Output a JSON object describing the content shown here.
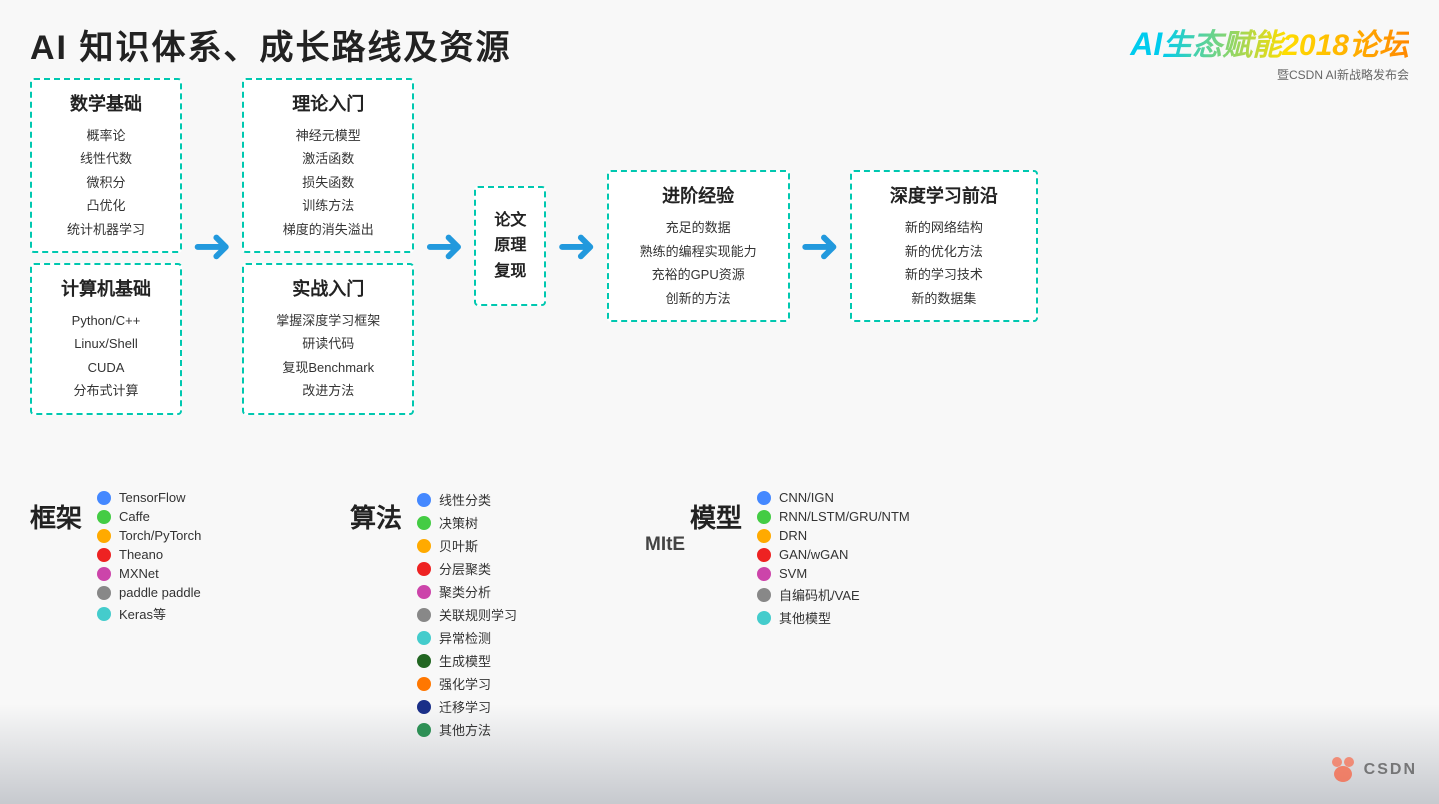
{
  "header": {
    "main_title": "AI 知识体系、成长路线及资源",
    "forum_title": "AI生态赋能2018论坛",
    "forum_subtitle": "暨CSDN AI新战略发布会"
  },
  "flow": {
    "box_math": {
      "title": "数学基础",
      "items": [
        "概率论",
        "线性代数",
        "微积分",
        "凸优化",
        "统计机器学习"
      ]
    },
    "box_cs": {
      "title": "计算机基础",
      "items": [
        "Python/C++",
        "Linux/Shell",
        "CUDA",
        "分布式计算"
      ]
    },
    "box_theory": {
      "title": "理论入门",
      "items": [
        "神经元模型",
        "激活函数",
        "损失函数",
        "训练方法",
        "梯度的消失溢出"
      ]
    },
    "box_practice": {
      "title": "实战入门",
      "items": [
        "掌握深度学习框架",
        "研读代码",
        "复现Benchmark",
        "改进方法"
      ]
    },
    "box_paper": {
      "title": "论文",
      "items": [
        "原理",
        "复现"
      ]
    },
    "box_advanced": {
      "title": "进阶经验",
      "items": [
        "充足的数据",
        "熟练的编程实现能力",
        "充裕的GPU资源",
        "创新的方法"
      ]
    },
    "box_deep": {
      "title": "深度学习前沿",
      "items": [
        "新的网络结构",
        "新的优化方法",
        "新的学习技术",
        "新的数据集"
      ]
    }
  },
  "frameworks": {
    "label": "框架",
    "items": [
      {
        "color": "blue",
        "name": "TensorFlow"
      },
      {
        "color": "green",
        "name": "Caffe"
      },
      {
        "color": "yellow",
        "name": "Torch/PyTorch"
      },
      {
        "color": "red",
        "name": "Theano"
      },
      {
        "color": "purple",
        "name": "MXNet"
      },
      {
        "color": "gray",
        "name": "paddle paddle"
      },
      {
        "color": "cyan",
        "name": "Keras等"
      }
    ]
  },
  "algorithms": {
    "label": "算法",
    "items": [
      {
        "color": "blue",
        "name": "线性分类"
      },
      {
        "color": "green",
        "name": "决策树"
      },
      {
        "color": "yellow",
        "name": "贝叶斯"
      },
      {
        "color": "red",
        "name": "分层聚类"
      },
      {
        "color": "purple",
        "name": "聚类分析"
      },
      {
        "color": "gray",
        "name": "关联规则学习"
      },
      {
        "color": "cyan",
        "name": "异常检测"
      },
      {
        "color": "darkgreen",
        "name": "生成模型"
      },
      {
        "color": "orange",
        "name": "强化学习"
      },
      {
        "color": "darkblue",
        "name": "迁移学习"
      },
      {
        "color": "darkgreen2",
        "name": "其他方法"
      }
    ]
  },
  "models": {
    "label": "模型",
    "items": [
      {
        "color": "blue",
        "name": "CNN/IGN"
      },
      {
        "color": "green",
        "name": "RNN/LSTM/GRU/NTM"
      },
      {
        "color": "yellow",
        "name": "DRN"
      },
      {
        "color": "red",
        "name": "GAN/wGAN"
      },
      {
        "color": "purple",
        "name": "SVM"
      },
      {
        "color": "gray",
        "name": "自编码机/VAE"
      },
      {
        "color": "cyan",
        "name": "其他模型"
      }
    ]
  },
  "mite_label": "MItE",
  "csdn_label": "CSDN"
}
